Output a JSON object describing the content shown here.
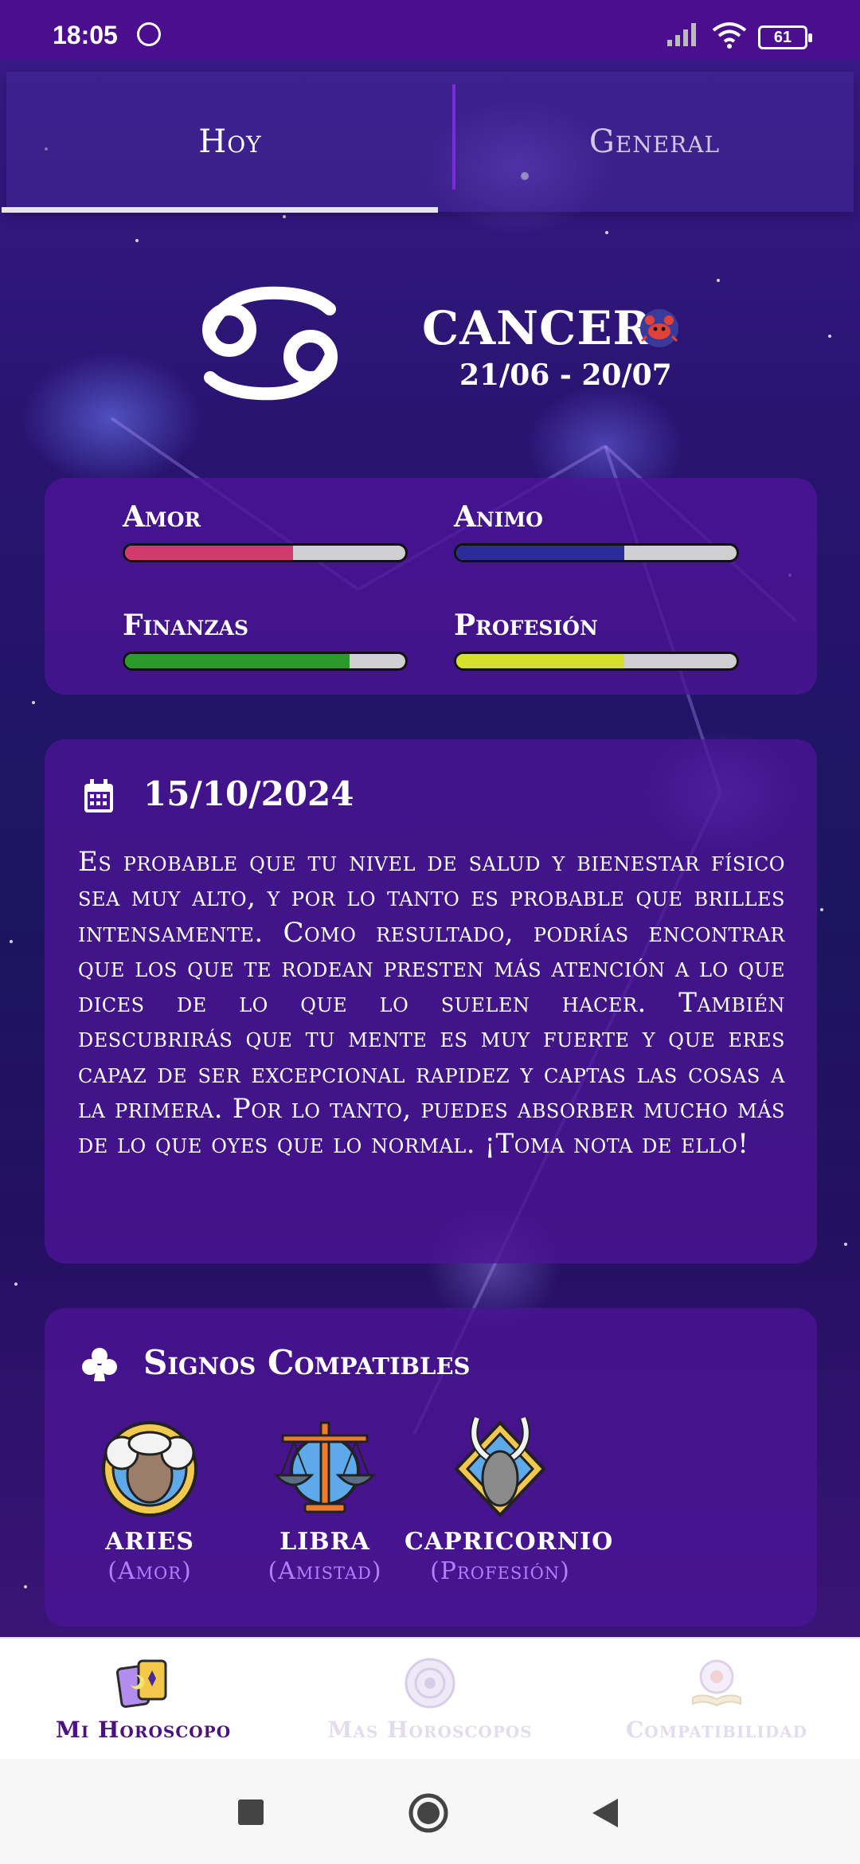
{
  "status_bar": {
    "time": "18:05",
    "battery": "61"
  },
  "tabs": [
    {
      "label": "Hoy"
    },
    {
      "label": "General"
    }
  ],
  "sign": {
    "name": "CANCER",
    "dates": "21/06 - 20/07"
  },
  "stats": [
    {
      "label": "Amor",
      "value": 0.6,
      "color": "#d23a6e"
    },
    {
      "label": "Animo",
      "value": 0.6,
      "color": "#2a2c9a"
    },
    {
      "label": "Finanzas",
      "value": 0.8,
      "color": "#2a9a2a"
    },
    {
      "label": "Profesión",
      "value": 0.6,
      "color": "#d6df2c"
    }
  ],
  "daily": {
    "date": "15/10/2024",
    "text": "Es probable que tu nivel de salud y bienestar físico sea muy alto, y por lo tanto es probable que brilles intensamente. Como resultado, podrías encontrar que los que te rodean presten más atención a lo que dices de lo que lo suelen hacer. También descubrirás que tu mente es muy fuerte y que eres capaz de ser excepcional rapidez y captas las cosas a la primera. Por lo tanto, puedes absorber mucho más de lo que oyes que lo normal. ¡Toma nota de ello!"
  },
  "compatible": {
    "title": "Signos Compatibles",
    "signs": [
      {
        "name": "ARIES",
        "relation": "(Amor)"
      },
      {
        "name": "LIBRA",
        "relation": "(Amistad)"
      },
      {
        "name": "CAPRICORNIO",
        "relation": "(Profesión)"
      }
    ]
  },
  "bottom_nav": [
    {
      "label": "Mi Horoscopo",
      "active": true
    },
    {
      "label": "Mas Horoscopos",
      "active": false
    },
    {
      "label": "Compatibilidad",
      "active": false
    }
  ]
}
